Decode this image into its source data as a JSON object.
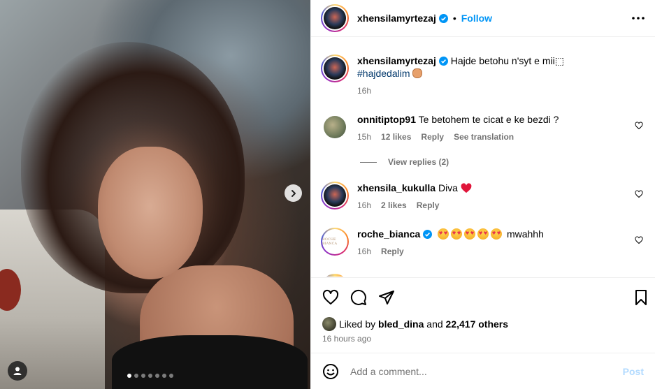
{
  "post": {
    "author": "xhensilamyrtezaj",
    "follow_label": "Follow",
    "bullet": "•",
    "caption_text": "Hajde betohu n'syt e mii⬚",
    "hashtag": "#hajdedalim",
    "caption_time": "16h"
  },
  "comments": [
    {
      "user": "onnitiptop91",
      "text": "Te betohem te cicat e ke bezdi ?",
      "time": "15h",
      "likes": "12 likes",
      "reply": "Reply",
      "translate": "See translation"
    },
    {
      "user": "xhensila_kukulla",
      "text": "Diva",
      "time": "16h",
      "likes": "2 likes",
      "reply": "Reply"
    },
    {
      "user": "roche_bianca",
      "text": "mwahhh",
      "time": "16h",
      "reply": "Reply",
      "avatar_text": "ROCHE BIANCA"
    }
  ],
  "view_replies": "View replies (2)",
  "likes": {
    "prefix": "Liked by",
    "user": "bled_dina",
    "and": "and",
    "count": "22,417 others"
  },
  "timestamp": "16 hours ago",
  "add_comment": {
    "placeholder": "Add a comment...",
    "post_label": "Post"
  },
  "carousel": {
    "slides": 7,
    "active": 0
  },
  "colors": {
    "accent": "#0095f6",
    "heart_red": "#ed4956",
    "muted": "#737373"
  }
}
